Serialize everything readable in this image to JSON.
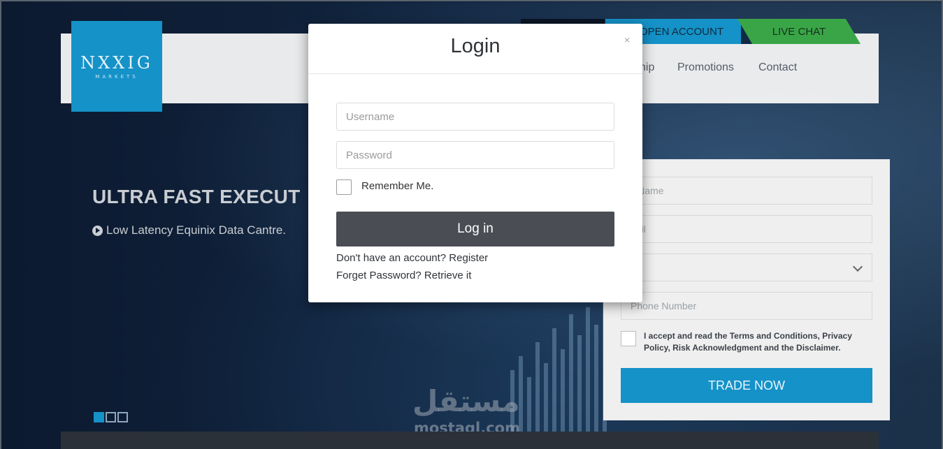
{
  "site": {
    "logo_main": "NXXIG",
    "logo_sub": "MARKETS"
  },
  "top_tabs": {
    "open_account": "OPEN ACCOUNT",
    "live_chat": "LIVE CHAT"
  },
  "nav": {
    "items": [
      "hip",
      "Promotions",
      "Contact"
    ]
  },
  "hero": {
    "title": "ULTRA FAST EXECUT",
    "bullet": "Low Latency Equinix Data Cantre."
  },
  "side_form": {
    "full_name_placeholder": "ll Name",
    "email_placeholder": "nail",
    "phone_placeholder": "Phone Number",
    "terms": "I accept and read the Terms and Conditions, Privacy Policy, Risk Acknowledgment and the Disclaimer.",
    "trade_button": "TRADE NOW"
  },
  "modal": {
    "title": "Login",
    "close": "×",
    "username_placeholder": "Username",
    "password_placeholder": "Password",
    "remember_label": "Remember Me.",
    "login_button": "Log in",
    "register_link": "Don't have an account? Register",
    "retrieve_link": "Forget Password? Retrieve it"
  },
  "watermark": {
    "arabic": "مستقل",
    "latin": "mostaql.com"
  },
  "colors": {
    "brand_blue": "#1592c8",
    "live_chat_green": "#3aa547",
    "login_button": "#4a4d53",
    "hero_bg": "#0e1d33"
  }
}
